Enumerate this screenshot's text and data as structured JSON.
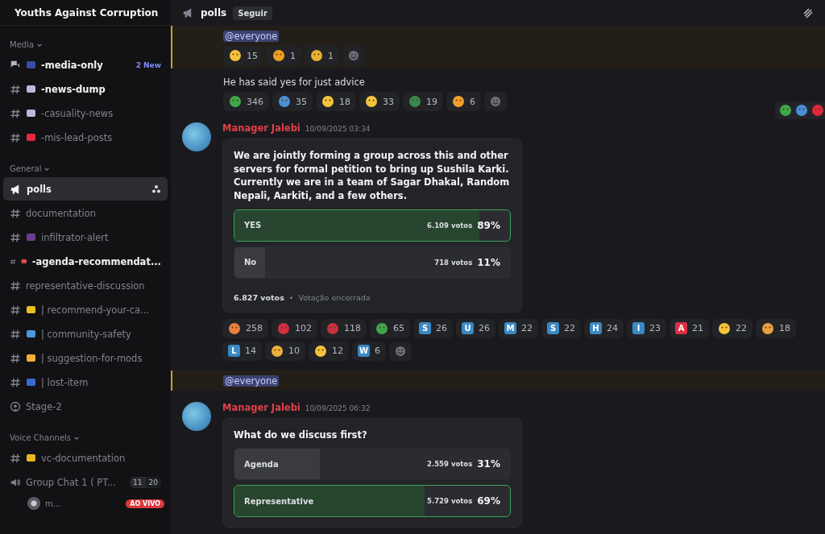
{
  "server": {
    "name": "Youths Against Corruption"
  },
  "sidebar": {
    "categories": [
      {
        "name": "Media",
        "channels": [
          {
            "kind": "forum",
            "color": "#3b4ca8",
            "name": "-media-only",
            "badge": "2 New",
            "unread": true,
            "selected": false
          },
          {
            "kind": "text",
            "color": "#b8bcd8",
            "name": "-news-dump",
            "unread": true,
            "selected": false
          },
          {
            "kind": "text",
            "color": "#b8bcd8",
            "name": "-casuality-news",
            "unread": false,
            "selected": false
          },
          {
            "kind": "text",
            "color": "#e8283c",
            "name": "-mis-lead-posts",
            "unread": false,
            "selected": false
          }
        ]
      },
      {
        "name": "General",
        "channels": [
          {
            "kind": "announcement",
            "name": "polls",
            "unread": true,
            "selected": true
          },
          {
            "kind": "text",
            "name": "documentation",
            "unread": false,
            "selected": false
          },
          {
            "kind": "text",
            "color": "#6a3d8c",
            "name": "infiltrator-alert",
            "unread": false,
            "selected": false
          },
          {
            "kind": "text",
            "color": "#e04848",
            "name": "-agenda-recommendat...",
            "unread": true,
            "selected": false
          },
          {
            "kind": "text",
            "name": "representative-discussion",
            "unread": false,
            "selected": false
          },
          {
            "kind": "text",
            "color": "#e8c020",
            "name": "| recommend-your-ca...",
            "unread": false,
            "selected": false
          },
          {
            "kind": "text",
            "color": "#4a9ae0",
            "name": "| community-safety",
            "unread": false,
            "selected": false
          },
          {
            "kind": "text",
            "color": "#f0b030",
            "name": "| suggestion-for-mods",
            "unread": false,
            "selected": false
          },
          {
            "kind": "text",
            "color": "#3a6ad0",
            "name": "| lost-item",
            "unread": false,
            "selected": false
          },
          {
            "kind": "stage",
            "name": "Stage-2",
            "unread": false,
            "selected": false
          }
        ]
      },
      {
        "name": "Voice Channels",
        "channels": [
          {
            "kind": "text",
            "color": "#e8b820",
            "name": "vc-documentation",
            "unread": false,
            "selected": false
          },
          {
            "kind": "voice",
            "name": "Group Chat 1 ( PT...",
            "count": "11",
            "limit": "20",
            "unread": false,
            "selected": false,
            "members": [
              {
                "name": "m...",
                "live": "AO VIVO"
              }
            ]
          }
        ]
      }
    ]
  },
  "header": {
    "channel": "polls",
    "follow": "Seguir"
  },
  "messages": [
    {
      "kind": "mention",
      "mention": "@everyone",
      "reactions": [
        {
          "kind": "emoji",
          "color": "#f5c33b",
          "count": "15"
        },
        {
          "kind": "emoji",
          "color": "#f0a020",
          "count": "1"
        },
        {
          "kind": "emoji",
          "color": "#e8b030",
          "count": "1"
        }
      ]
    },
    {
      "kind": "text",
      "text": "He has said yes for just advice",
      "reactions": [
        {
          "kind": "emoji",
          "color": "#3fa84a",
          "count": "346"
        },
        {
          "kind": "emoji",
          "color": "#4a90d8",
          "count": "35"
        },
        {
          "kind": "emoji",
          "color": "#f5c33b",
          "count": "18"
        },
        {
          "kind": "emoji",
          "color": "#f5c33b",
          "count": "33"
        },
        {
          "kind": "emoji",
          "color": "#3a8a50",
          "count": "19"
        },
        {
          "kind": "emoji",
          "color": "#f0a030",
          "count": "6"
        }
      ]
    },
    {
      "kind": "poll",
      "author": "Manager Jalebi",
      "time": "10/09/2025 03:34",
      "hover_reactions": [
        {
          "color": "#3fa84a"
        },
        {
          "color": "#4a90d8"
        },
        {
          "color": "#e0283c"
        }
      ],
      "question": "We are jointly forming a group across this and other servers for formal petition to bring up Sushila Karki. Currently we are in a team of Sagar Dhakal, Random Nepali, Aarkiti, and a few others.",
      "answers": [
        {
          "label": "YES",
          "votes": "6.109 votos",
          "percent": "89%",
          "level": 0.89,
          "selected": true
        },
        {
          "label": "No",
          "votes": "718 votos",
          "percent": "11%",
          "level": 0.11,
          "selected": false
        }
      ],
      "total": "6.827 votos",
      "separator": "•",
      "status": "Votação encerrada",
      "reactions": [
        {
          "kind": "emoji",
          "color": "#e88040",
          "count": "258"
        },
        {
          "kind": "emoji",
          "color": "#d03040",
          "count": "102"
        },
        {
          "kind": "emoji",
          "color": "#c83040",
          "count": "118"
        },
        {
          "kind": "emoji",
          "color": "#3fa84a",
          "count": "65"
        },
        {
          "kind": "letter",
          "letter": "S",
          "color": "#3b88c3",
          "count": "26"
        },
        {
          "kind": "letter",
          "letter": "U",
          "color": "#3b88c3",
          "count": "26"
        },
        {
          "kind": "letter",
          "letter": "M",
          "color": "#3b88c3",
          "count": "22"
        },
        {
          "kind": "letter",
          "letter": "S",
          "color": "#3b88c3",
          "count": "22"
        },
        {
          "kind": "letter",
          "letter": "H",
          "color": "#3b88c3",
          "count": "24"
        },
        {
          "kind": "letter",
          "letter": "I",
          "color": "#3b88c3",
          "count": "23"
        },
        {
          "kind": "letter",
          "letter": "A",
          "color": "#dd2e44",
          "count": "21"
        },
        {
          "kind": "emoji",
          "color": "#f5c33b",
          "count": "22"
        },
        {
          "kind": "emoji",
          "color": "#e8a040",
          "count": "18"
        },
        {
          "kind": "letter",
          "letter": "L",
          "color": "#3b88c3",
          "count": "14"
        },
        {
          "kind": "emoji",
          "color": "#f0b040",
          "count": "10"
        },
        {
          "kind": "emoji",
          "color": "#f5c33b",
          "count": "12"
        },
        {
          "kind": "letter",
          "letter": "W",
          "color": "#3b88c3",
          "count": "6"
        }
      ]
    },
    {
      "kind": "mention",
      "mention": "@everyone"
    },
    {
      "kind": "poll",
      "author": "Manager Jalebi",
      "time": "10/09/2025 06:32",
      "question": "What do we discuss first?",
      "answers": [
        {
          "label": "Agenda",
          "votes": "2.559 votos",
          "percent": "31%",
          "level": 0.31,
          "selected": false
        },
        {
          "label": "Representative",
          "votes": "5.729 votos",
          "percent": "69%",
          "level": 0.69,
          "selected": true
        }
      ]
    }
  ]
}
